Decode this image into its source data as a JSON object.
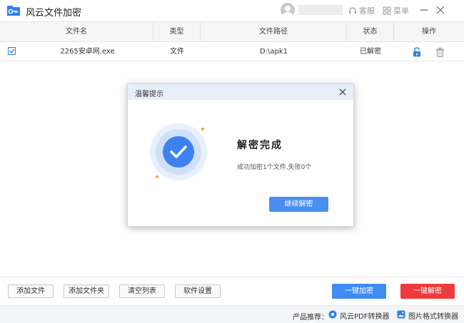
{
  "app": {
    "title": "风云文件加密",
    "service_label": "客服",
    "menu_label": "菜单"
  },
  "table": {
    "headers": [
      "文件名",
      "类型",
      "文件路径",
      "状态",
      "操作"
    ],
    "rows": [
      {
        "checked": true,
        "name": "2265安卓网.exe",
        "type": "文件",
        "path": "D:\\apk1",
        "status": "已解密"
      }
    ]
  },
  "dialog": {
    "title": "温馨提示",
    "heading": "解密完成",
    "message": "成功加密1个文件,失败0个",
    "button_label": "继续解密"
  },
  "toolbar": {
    "add_file": "添加文件",
    "add_folder": "添加文件夹",
    "clear_list": "清空列表",
    "settings": "软件设置",
    "encrypt_all": "一键加密",
    "decrypt_all": "一键解密"
  },
  "footer": {
    "label": "产品推荐：",
    "pdf_converter": "风云PDF转换器",
    "image_converter": "图片格式转换器"
  },
  "colors": {
    "accent_blue": "#3f8cf3",
    "danger_red": "#ee3a3a",
    "lock_blue": "#2f80ed",
    "dot_orange": "#f5a623"
  }
}
